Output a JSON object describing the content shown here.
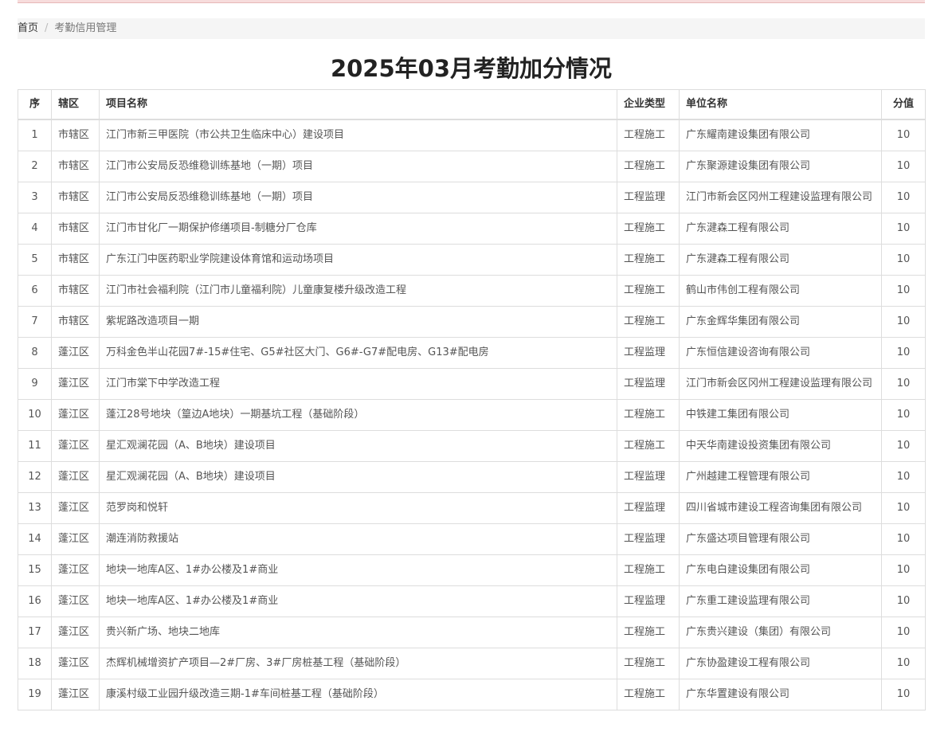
{
  "breadcrumb": {
    "home": "首页",
    "separator": "/",
    "current": "考勤信用管理"
  },
  "page": {
    "title": "2025年03月考勤加分情况"
  },
  "table": {
    "headers": {
      "seq": "序",
      "district": "辖区",
      "project": "项目名称",
      "type": "企业类型",
      "company": "单位名称",
      "score": "分值"
    },
    "rows": [
      {
        "seq": "1",
        "district": "市辖区",
        "project": "江门市新三甲医院（市公共卫生临床中心）建设项目",
        "type": "工程施工",
        "company": "广东耀南建设集团有限公司",
        "score": "10"
      },
      {
        "seq": "2",
        "district": "市辖区",
        "project": "江门市公安局反恐维稳训练基地（一期）项目",
        "type": "工程施工",
        "company": "广东聚源建设集团有限公司",
        "score": "10"
      },
      {
        "seq": "3",
        "district": "市辖区",
        "project": "江门市公安局反恐维稳训练基地（一期）项目",
        "type": "工程监理",
        "company": "江门市新会区冈州工程建设监理有限公司",
        "score": "10"
      },
      {
        "seq": "4",
        "district": "市辖区",
        "project": "江门市甘化厂一期保护修缮项目-制糖分厂仓库",
        "type": "工程施工",
        "company": "广东湕森工程有限公司",
        "score": "10"
      },
      {
        "seq": "5",
        "district": "市辖区",
        "project": "广东江门中医药职业学院建设体育馆和运动场项目",
        "type": "工程施工",
        "company": "广东湕森工程有限公司",
        "score": "10"
      },
      {
        "seq": "6",
        "district": "市辖区",
        "project": "江门市社会福利院（江门市儿童福利院）儿童康复楼升级改造工程",
        "type": "工程施工",
        "company": "鹤山市伟创工程有限公司",
        "score": "10"
      },
      {
        "seq": "7",
        "district": "市辖区",
        "project": "紫坭路改造项目一期",
        "type": "工程施工",
        "company": "广东金辉华集团有限公司",
        "score": "10"
      },
      {
        "seq": "8",
        "district": "蓬江区",
        "project": "万科金色半山花园7#-15#住宅、G5#社区大门、G6#-G7#配电房、G13#配电房",
        "type": "工程监理",
        "company": "广东恒信建设咨询有限公司",
        "score": "10"
      },
      {
        "seq": "9",
        "district": "蓬江区",
        "project": "江门市棠下中学改造工程",
        "type": "工程监理",
        "company": "江门市新会区冈州工程建设监理有限公司",
        "score": "10"
      },
      {
        "seq": "10",
        "district": "蓬江区",
        "project": "蓬江28号地块（篁边A地块）一期基坑工程（基础阶段）",
        "type": "工程施工",
        "company": "中铁建工集团有限公司",
        "score": "10"
      },
      {
        "seq": "11",
        "district": "蓬江区",
        "project": "星汇观澜花园（A、B地块）建设项目",
        "type": "工程施工",
        "company": "中天华南建设投资集团有限公司",
        "score": "10"
      },
      {
        "seq": "12",
        "district": "蓬江区",
        "project": "星汇观澜花园（A、B地块）建设项目",
        "type": "工程监理",
        "company": "广州越建工程管理有限公司",
        "score": "10"
      },
      {
        "seq": "13",
        "district": "蓬江区",
        "project": "范罗岗和悦轩",
        "type": "工程监理",
        "company": "四川省城市建设工程咨询集团有限公司",
        "score": "10"
      },
      {
        "seq": "14",
        "district": "蓬江区",
        "project": "潮连消防救援站",
        "type": "工程监理",
        "company": "广东盛达项目管理有限公司",
        "score": "10"
      },
      {
        "seq": "15",
        "district": "蓬江区",
        "project": "地块一地库A区、1#办公楼及1#商业",
        "type": "工程施工",
        "company": "广东电白建设集团有限公司",
        "score": "10"
      },
      {
        "seq": "16",
        "district": "蓬江区",
        "project": "地块一地库A区、1#办公楼及1#商业",
        "type": "工程监理",
        "company": "广东重工建设监理有限公司",
        "score": "10"
      },
      {
        "seq": "17",
        "district": "蓬江区",
        "project": "贵兴新广场、地块二地库",
        "type": "工程施工",
        "company": "广东贵兴建设（集团）有限公司",
        "score": "10"
      },
      {
        "seq": "18",
        "district": "蓬江区",
        "project": "杰辉机械增资扩产项目—2#厂房、3#厂房桩基工程（基础阶段）",
        "type": "工程施工",
        "company": "广东协盈建设工程有限公司",
        "score": "10"
      },
      {
        "seq": "19",
        "district": "蓬江区",
        "project": "康溪村级工业园升级改造三期-1#车间桩基工程（基础阶段）",
        "type": "工程施工",
        "company": "广东华置建设有限公司",
        "score": "10"
      }
    ]
  }
}
